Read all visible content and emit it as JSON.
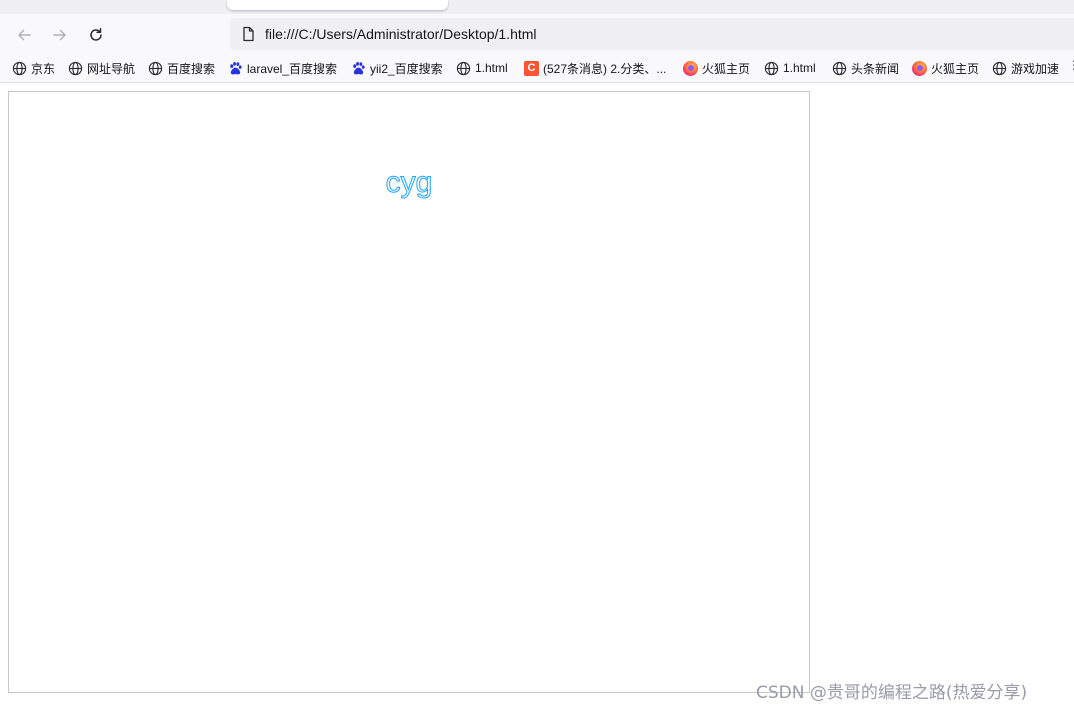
{
  "browser": {
    "url": "file:///C:/Users/Administrator/Desktop/1.html"
  },
  "bookmarks": [
    {
      "label": "京东",
      "icon": "globe-icon"
    },
    {
      "label": "网址导航",
      "icon": "globe-icon"
    },
    {
      "label": "百度搜索",
      "icon": "globe-icon"
    },
    {
      "label": "laravel_百度搜索",
      "icon": "baidu-paw-icon"
    },
    {
      "label": "yii2_百度搜索",
      "icon": "baidu-paw-icon"
    },
    {
      "label": "1.html",
      "icon": "globe-icon"
    },
    {
      "label": "(527条消息) 2.分类、...",
      "icon": "csdn-icon"
    },
    {
      "label": "火狐主页",
      "icon": "firefox-icon"
    },
    {
      "label": "1.html",
      "icon": "globe-icon"
    },
    {
      "label": "头条新闻",
      "icon": "globe-icon"
    },
    {
      "label": "火狐主页",
      "icon": "firefox-icon"
    },
    {
      "label": "游戏加速",
      "icon": "globe-icon"
    }
  ],
  "content": {
    "stroked_text": "cyg",
    "stroke_color": "#1aa3ff"
  },
  "watermark": "CSDN @贵哥的编程之路(热爱分享)"
}
